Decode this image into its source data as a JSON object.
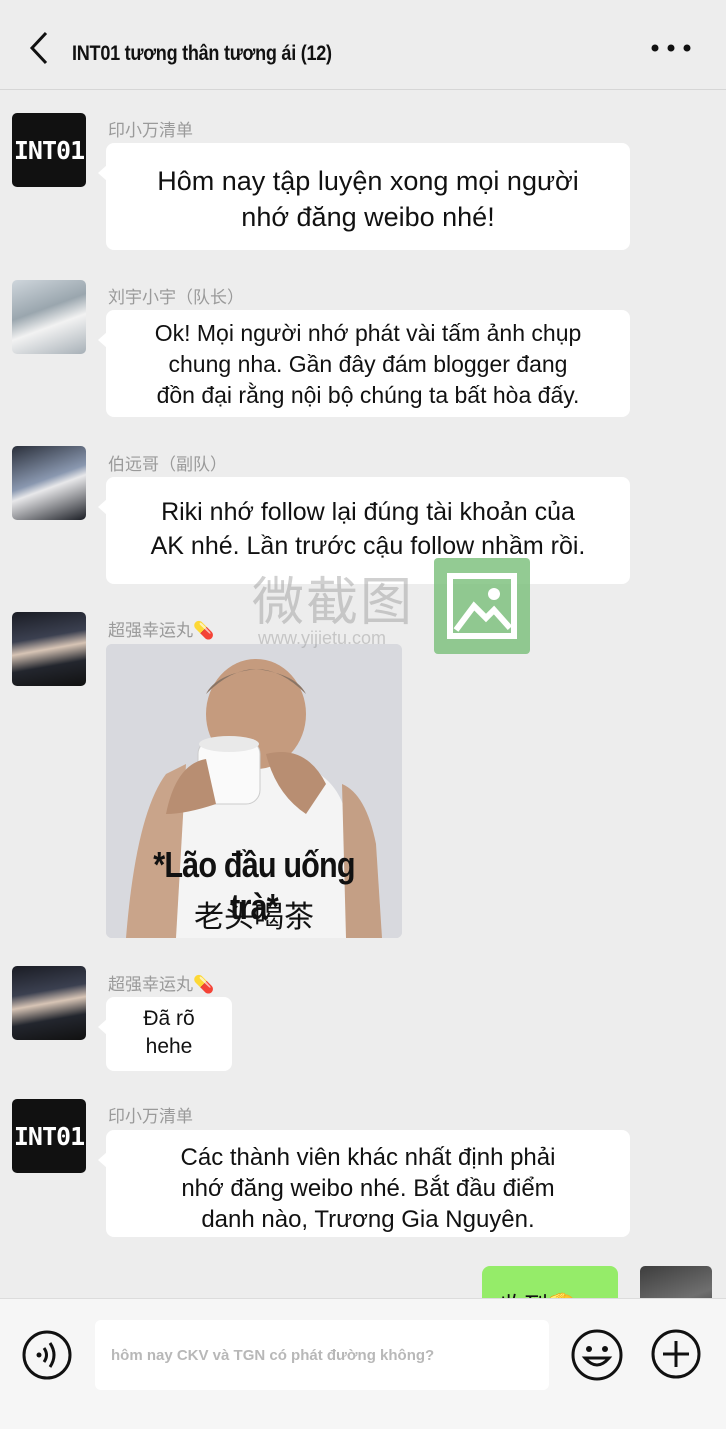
{
  "header": {
    "title": "INT01 tương thân tương ái (12)",
    "back_icon": "chevron-left-icon",
    "more_icon": "more-dots-icon"
  },
  "messages": [
    {
      "sender": "印小万清单",
      "avatar_text": "INT01",
      "lines": [
        "Hôm nay tập luyện xong mọi người",
        "nhớ đăng weibo nhé!"
      ]
    },
    {
      "sender": "刘宇小宇（队长）",
      "lines": [
        "Ok! Mọi người nhớ phát vài tấm ảnh chụp",
        "chung nha. Gần đây đám blogger đang",
        "đồn đại rằng nội bộ chúng ta bất hòa đấy."
      ]
    },
    {
      "sender": "伯远哥（副队）",
      "lines": [
        "Riki nhớ follow lại đúng tài khoản của",
        "AK nhé. Lần trước cậu follow nhầm rồi."
      ]
    },
    {
      "sender": "超强幸运丸💊",
      "sticker_caption_vi": "*Lão đầu uống trà*",
      "sticker_caption_zh": "老头喝茶"
    },
    {
      "sender": "超强幸运丸💊",
      "lines": [
        "Đã rõ",
        "hehe"
      ]
    },
    {
      "sender": "印小万清单",
      "avatar_text": "INT01",
      "lines": [
        "Các thành viên khác nhất định phải",
        "nhớ đăng weibo nhé. Bắt đầu điểm",
        "danh nào, Trương Gia Nguyên."
      ]
    }
  ],
  "my_message": {
    "text": "收到🫡"
  },
  "watermark": {
    "text": "微截图",
    "url": "www.yijietu.com"
  },
  "input_bar": {
    "placeholder": "hôm nay CKV và TGN có phát đường không?",
    "voice_icon": "voice-icon",
    "emoji_icon": "emoji-icon",
    "plus_icon": "plus-icon"
  },
  "colors": {
    "background": "#ededed",
    "my_bubble": "#95ec69",
    "other_bubble": "#ffffff"
  }
}
